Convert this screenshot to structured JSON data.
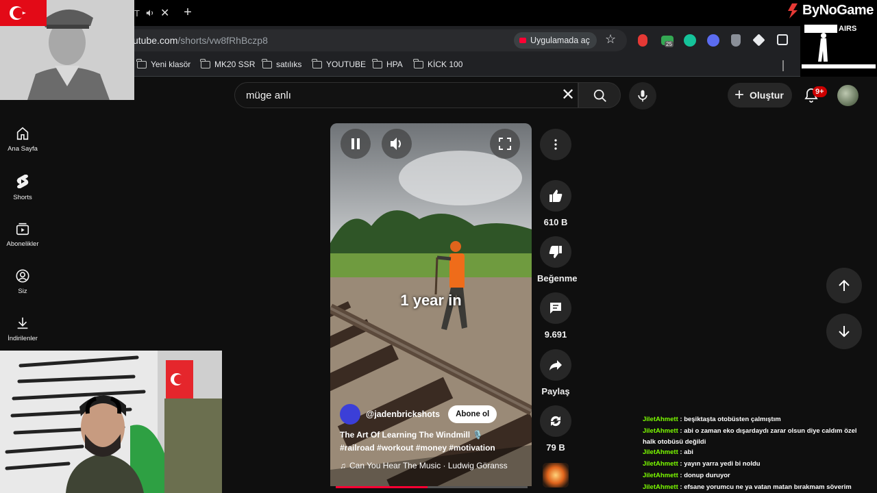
{
  "browser": {
    "tab_title": "T",
    "url_host": "utube.com",
    "url_path": "/shorts/vw8fRhBczp8",
    "open_in_app": "Uygulamada aç",
    "extension_badge": "25",
    "bookmarks": [
      {
        "label": "Yeni klasör"
      },
      {
        "label": "MK20 SSR"
      },
      {
        "label": "satılıks"
      },
      {
        "label": "YOUTUBE"
      },
      {
        "label": "HPA"
      },
      {
        "label": "KİCK 100"
      }
    ]
  },
  "overlay": {
    "brand": "ByNoGame",
    "airs_label": "AIRS"
  },
  "header": {
    "search_value": "müge anlı",
    "create_label": "Oluştur",
    "notification_count": "9+"
  },
  "sidebar": {
    "items": [
      {
        "label": "Ana Sayfa",
        "icon": "home-icon"
      },
      {
        "label": "Shorts",
        "icon": "shorts-icon"
      },
      {
        "label": "Abonelikler",
        "icon": "subscriptions-icon"
      },
      {
        "label": "Siz",
        "icon": "profile-icon"
      },
      {
        "label": "İndirilenler",
        "icon": "download-icon"
      }
    ]
  },
  "short": {
    "caption_overlay": "1 year in",
    "channel": "@jadenbrickshots",
    "subscribe_label": "Abone ol",
    "title": "The Art Of Learning The Windmill 🎙️",
    "hashtags": "#railroad #workout #money #motivation",
    "music": "Can You Hear The Music · Ludwig Göranss",
    "progress_percent": 48
  },
  "actions": {
    "likes": "610 B",
    "dislike_label": "Beğenme",
    "comments": "9.691",
    "share_label": "Paylaş",
    "remix_count": "79 B"
  },
  "chat": [
    {
      "user": "JiletAhmett",
      "text": "beşiktaşta otobüsten çalmıştım"
    },
    {
      "user": "JiletAhmett",
      "text": "abi o zaman eko dışardaydı zarar olsun diye caldım özel halk otobüsü değildi"
    },
    {
      "user": "JiletAhmett",
      "text": "abi"
    },
    {
      "user": "JiletAhmett",
      "text": "yayın yarra yedi bi noldu"
    },
    {
      "user": "JiletAhmett",
      "text": "donup duruyor"
    },
    {
      "user": "JiletAhmett",
      "text": "efsane yorumcu ne ya vatan matan bırakmam söverim"
    }
  ],
  "colors": {
    "youtube_red": "#ff0033",
    "chat_username": "#7cfc00",
    "flag_red": "#e30a17"
  }
}
